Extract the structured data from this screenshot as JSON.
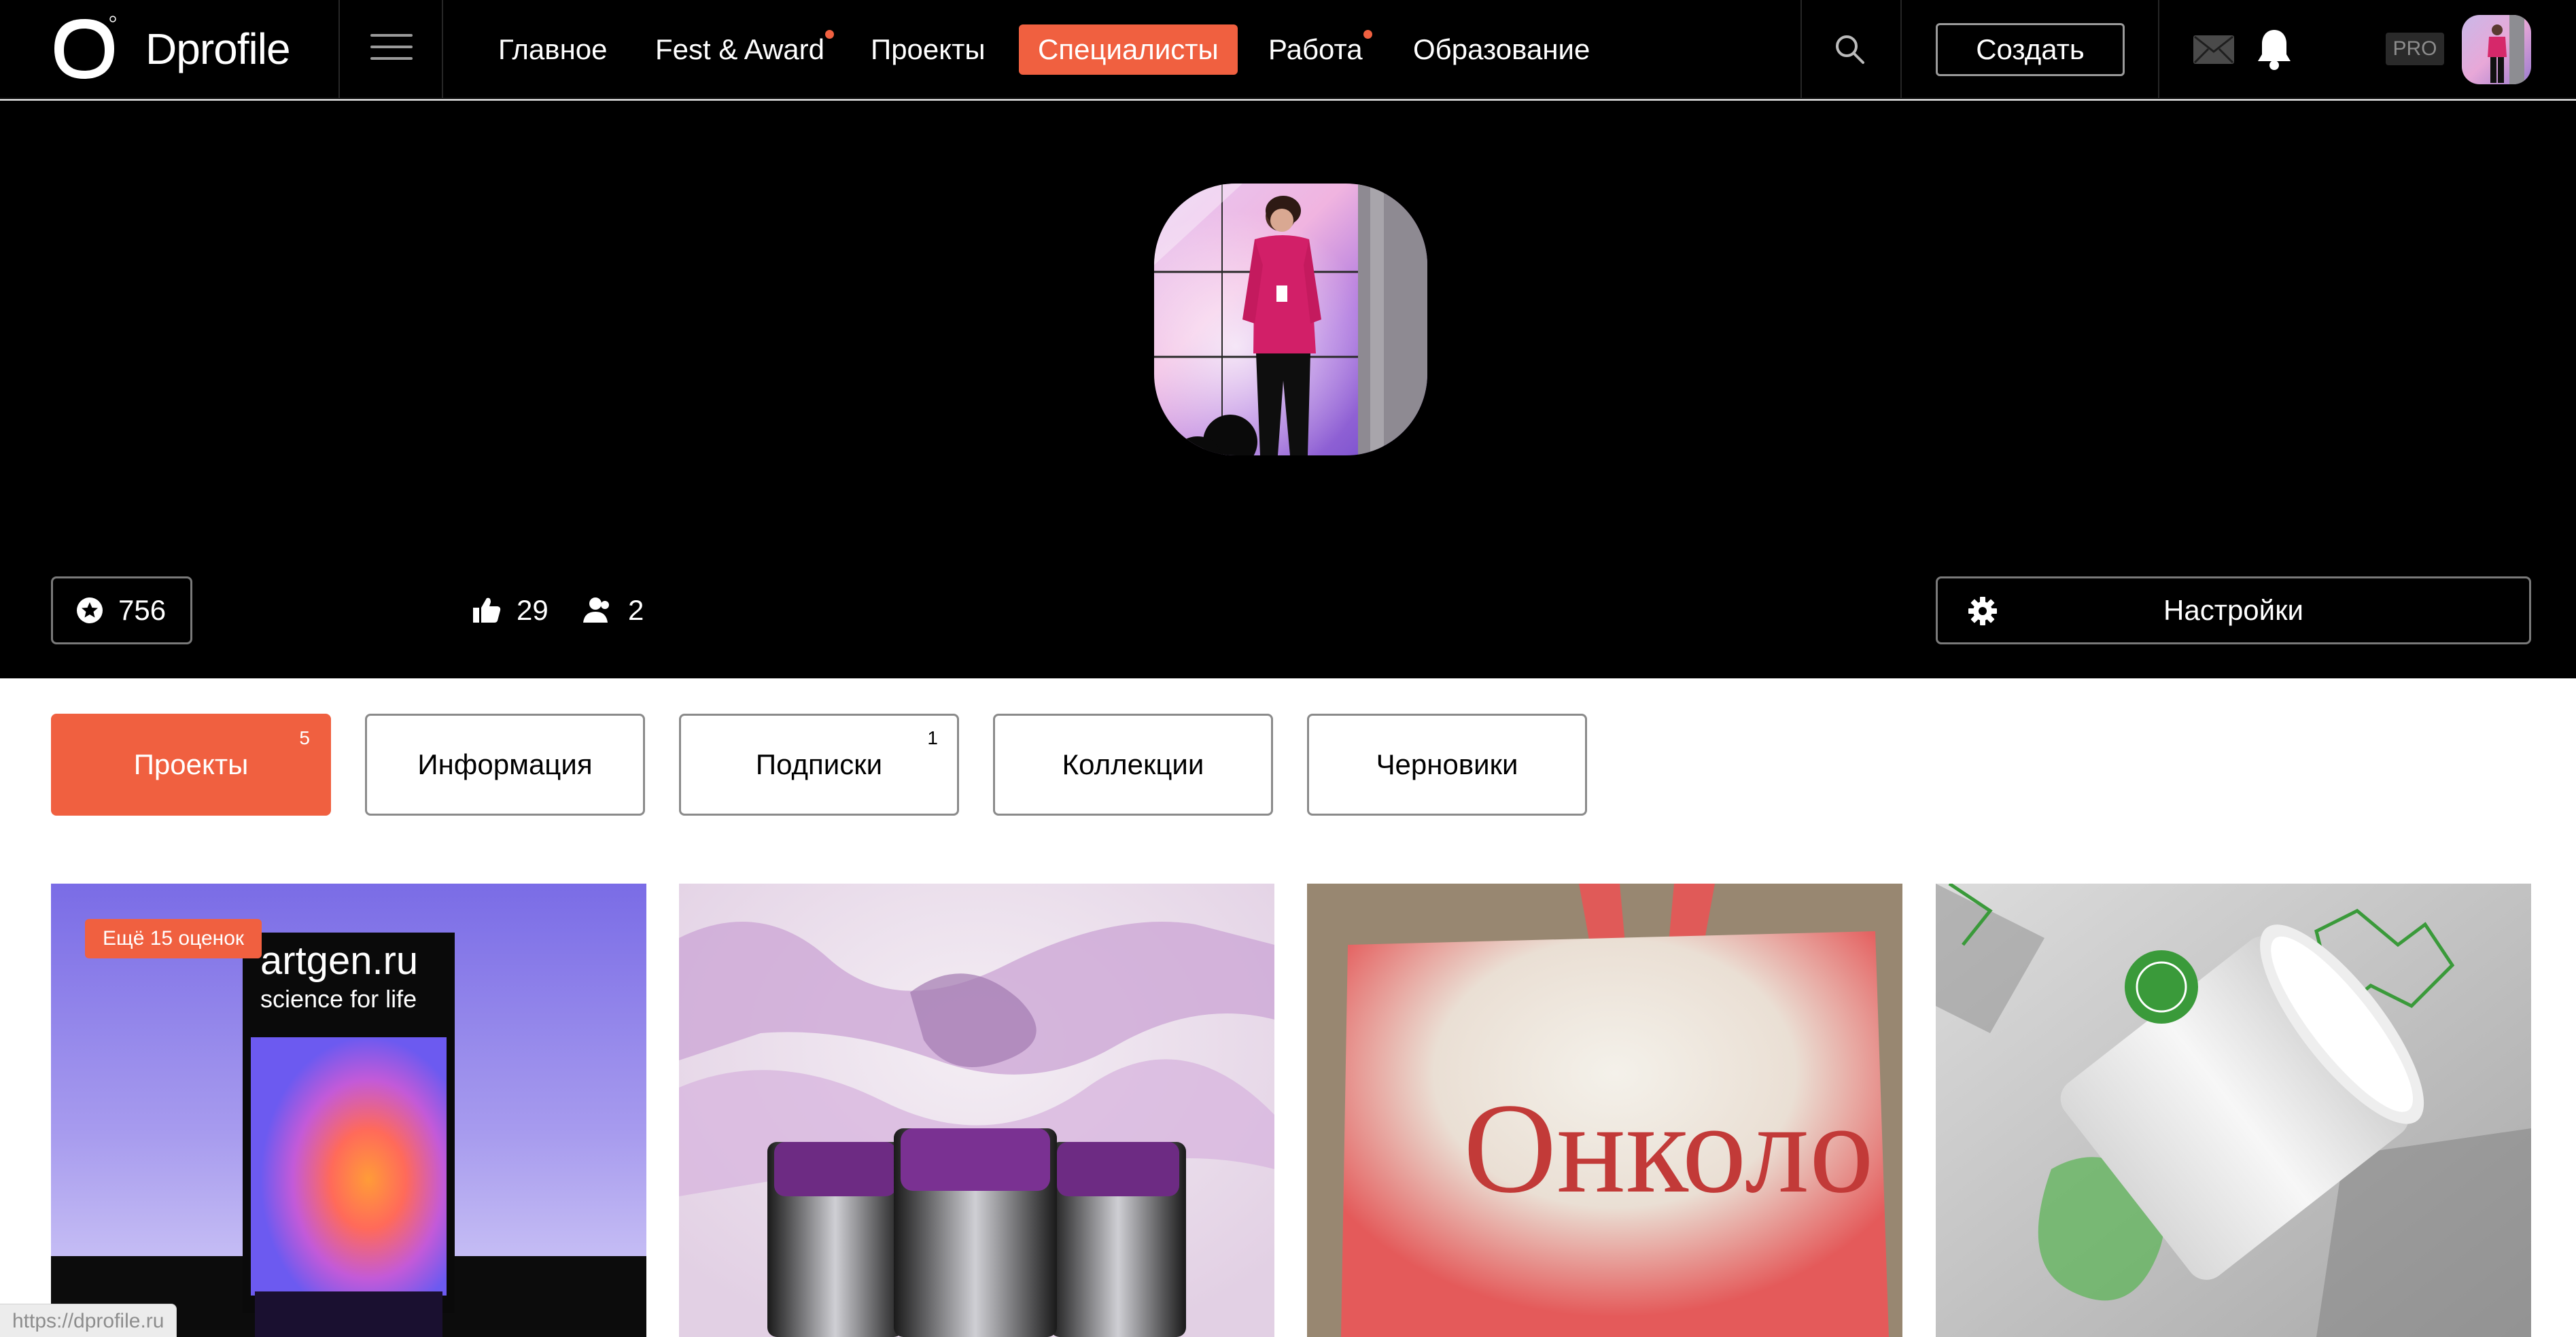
{
  "app": {
    "logo_text": "Dprofile"
  },
  "nav": {
    "items": [
      {
        "label": "Главное",
        "dot": false,
        "active": false
      },
      {
        "label": "Fest & Award",
        "dot": true,
        "active": false
      },
      {
        "label": "Проекты",
        "dot": false,
        "active": false
      },
      {
        "label": "Специалисты",
        "dot": false,
        "active": true
      },
      {
        "label": "Работа",
        "dot": true,
        "active": false
      },
      {
        "label": "Образование",
        "dot": false,
        "active": false
      }
    ],
    "create_label": "Создать",
    "pro_label": "PRO"
  },
  "profile": {
    "rating": "756",
    "likes": "29",
    "followers": "2",
    "settings_label": "Настройки"
  },
  "tabs": [
    {
      "label": "Проекты",
      "count": "5",
      "active": true
    },
    {
      "label": "Информация",
      "count": "",
      "active": false
    },
    {
      "label": "Подписки",
      "count": "1",
      "active": false
    },
    {
      "label": "Коллекции",
      "count": "",
      "active": false
    },
    {
      "label": "Черновики",
      "count": "",
      "active": false
    }
  ],
  "projects": [
    {
      "badge": "Ещё 15 оценок",
      "title_line1": "artgen.ru",
      "title_line2": "science for life"
    },
    {
      "badge": ""
    },
    {
      "badge": "",
      "bag_text": "Онколо"
    },
    {
      "badge": ""
    }
  ],
  "status_bar": {
    "url": "https://dprofile.ru"
  },
  "colors": {
    "accent": "#f06040",
    "nav_bg": "#000000",
    "hero_bg": "#000000"
  }
}
